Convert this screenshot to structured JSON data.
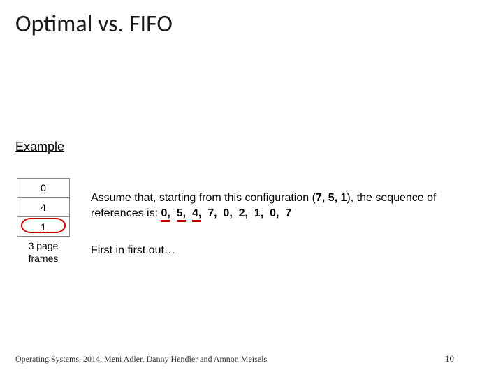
{
  "title": "Optimal vs. FIFO",
  "example_heading": "Example",
  "frames": {
    "f0": "0",
    "f1": "4",
    "f2": "1",
    "label": "3 page frames"
  },
  "body": {
    "pre": "Assume that, starting from this configuration (",
    "cfg": "7, 5, 1",
    "mid": "), the sequence of references is: ",
    "r0": "0,",
    "r1": "5,",
    "r2": "4,",
    "r3": "7,",
    "r4": "0,",
    "r5": "2,",
    "r6": "1,",
    "r7": "0,",
    "r8": "7"
  },
  "fifo": "First in first out…",
  "footer": "Operating Systems, 2014, Meni Adler, Danny Hendler and Amnon Meisels",
  "pagenum": "10"
}
